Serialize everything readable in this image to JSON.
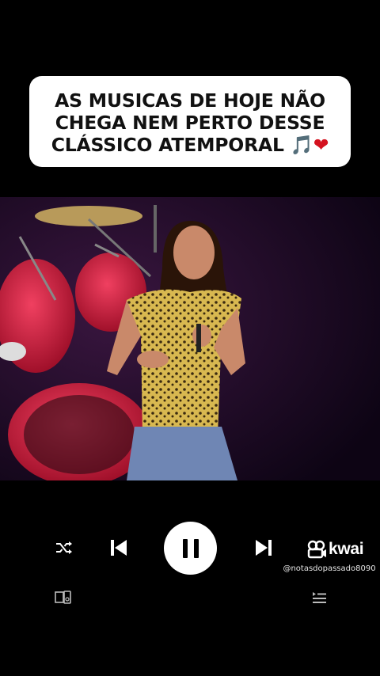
{
  "caption": {
    "line1": "AS MUSICAS DE HOJE NÃO",
    "line2": "CHEGA NEM PERTO DESSE",
    "line3": "CLÁSSICO ATEMPORAL ",
    "emoji_note": "🎵",
    "emoji_heart": "❤"
  },
  "player": {
    "shuffle_icon": "shuffle-icon",
    "previous_icon": "skip-previous-icon",
    "play_state": "pause-icon",
    "next_icon": "skip-next-icon",
    "devices_icon": "devices-icon",
    "queue_icon": "queue-icon"
  },
  "watermark": {
    "brand": "kwai",
    "handle": "@notasdopassado8090"
  },
  "colors": {
    "background": "#000000",
    "caption_bg": "#ffffff",
    "accent_heart": "#d4121f",
    "stage_bg": "#1b0a26",
    "drum_red": "#c8102e"
  }
}
